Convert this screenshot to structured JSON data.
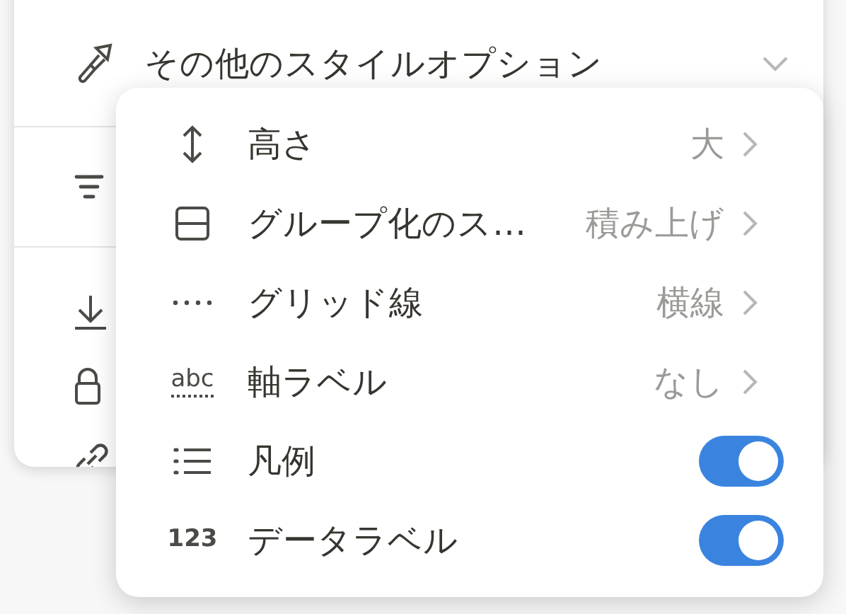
{
  "panel": {
    "title": "その他のスタイルオプション"
  },
  "menu": [
    {
      "kind": "submenu",
      "label": "高さ",
      "value": "大"
    },
    {
      "kind": "submenu",
      "label": "グループ化のス…",
      "value": "積み上げ"
    },
    {
      "kind": "submenu",
      "label": "グリッド線",
      "value": "横線"
    },
    {
      "kind": "submenu",
      "label": "軸ラベル",
      "value": "なし",
      "icon_text": "abc"
    },
    {
      "kind": "toggle",
      "label": "凡例",
      "on": true
    },
    {
      "kind": "toggle",
      "label": "データラベル",
      "on": true,
      "icon_text": "123"
    }
  ]
}
